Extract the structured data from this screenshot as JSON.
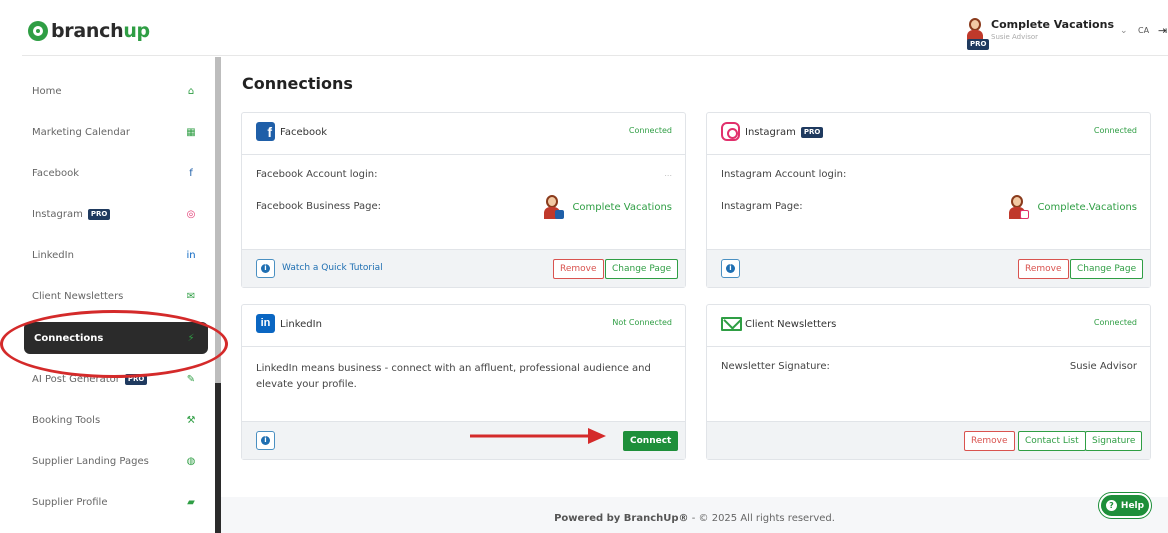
{
  "brand": {
    "prefix": "branch",
    "suffix": "up"
  },
  "account": {
    "name": "Complete Vacations",
    "sub": "Susie Advisor",
    "badge": "PRO",
    "lang": "CA",
    "caret": "⌄",
    "logout_icon": "⇥"
  },
  "sidebar": {
    "items": [
      {
        "label": "Home",
        "icon": "⌂"
      },
      {
        "label": "Marketing Calendar",
        "icon": "▦"
      },
      {
        "label": "Facebook",
        "icon": "f"
      },
      {
        "label": "Instagram",
        "icon": "◎",
        "badge": "PRO"
      },
      {
        "label": "LinkedIn",
        "icon": "in"
      },
      {
        "label": "Client Newsletters",
        "icon": "✉"
      },
      {
        "label": "Connections",
        "icon": "⚡"
      },
      {
        "label": "AI Post Generator",
        "icon": "✎",
        "badge": "PRO"
      },
      {
        "label": "Booking Tools",
        "icon": "⚒"
      },
      {
        "label": "Supplier Landing Pages",
        "icon": "◍"
      },
      {
        "label": "Supplier Profile",
        "icon": "▰"
      }
    ]
  },
  "page": {
    "title": "Connections"
  },
  "cards": {
    "facebook": {
      "title": "Facebook",
      "status": "Connected",
      "login_label": "Facebook Account login:",
      "login_value": "...",
      "page_label": "Facebook Business Page:",
      "page_value": "Complete Vacations",
      "tutorial": "Watch a Quick Tutorial",
      "remove": "Remove",
      "change": "Change Page",
      "info": "i"
    },
    "instagram": {
      "title": "Instagram",
      "badge": "PRO",
      "status": "Connected",
      "login_label": "Instagram Account login:",
      "page_label": "Instagram Page:",
      "page_value": "Complete.Vacations",
      "remove": "Remove",
      "change": "Change Page",
      "info": "i"
    },
    "linkedin": {
      "title": "LinkedIn",
      "status": "Not Connected",
      "logo": "in",
      "description": "LinkedIn means business - connect with an affluent, professional audience and elevate your profile.",
      "connect": "Connect",
      "info": "i"
    },
    "newsletters": {
      "title": "Client Newsletters",
      "status": "Connected",
      "signature_label": "Newsletter Signature:",
      "signature_value": "Susie Advisor",
      "remove": "Remove",
      "contact": "Contact List",
      "signature_btn": "Signature"
    }
  },
  "footer": {
    "powered": "Powered by BranchUp®",
    "copy": " - © 2025 All rights reserved."
  },
  "help": {
    "label": "Help",
    "icon": "?"
  },
  "colors": {
    "brand_green": "#2f9e44",
    "dark": "#2b2b2b",
    "annotation_red": "#d42a2a",
    "facebook": "#1f5fa8"
  }
}
